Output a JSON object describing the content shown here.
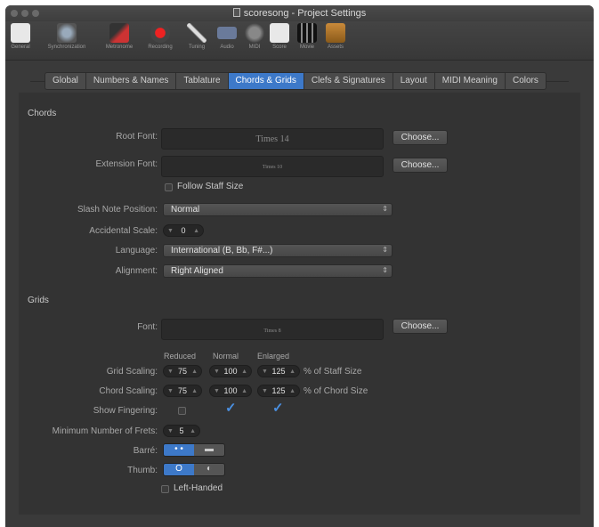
{
  "window": {
    "title": "scoresong - Project Settings"
  },
  "toolbar": {
    "items": [
      {
        "label": "General",
        "icon": "general-icon"
      },
      {
        "label": "Synchronization",
        "icon": "sync-icon"
      },
      {
        "label": "Metronome",
        "icon": "metronome-icon"
      },
      {
        "label": "Recording",
        "icon": "record-icon"
      },
      {
        "label": "Tuning",
        "icon": "tuning-icon"
      },
      {
        "label": "Audio",
        "icon": "audio-icon"
      },
      {
        "label": "MIDI",
        "icon": "midi-icon"
      },
      {
        "label": "Score",
        "icon": "score-icon"
      },
      {
        "label": "Movie",
        "icon": "movie-icon"
      },
      {
        "label": "Assets",
        "icon": "assets-icon"
      }
    ]
  },
  "tabs": [
    "Global",
    "Numbers & Names",
    "Tablature",
    "Chords & Grids",
    "Clefs & Signatures",
    "Layout",
    "MIDI Meaning",
    "Colors"
  ],
  "active_tab": "Chords & Grids",
  "chords": {
    "heading": "Chords",
    "root_font_label": "Root Font:",
    "root_font_value": "Times 14",
    "extension_font_label": "Extension Font:",
    "extension_font_value": "Times 10",
    "choose_label": "Choose...",
    "follow_staff_size": "Follow Staff Size",
    "slash_note_label": "Slash Note Position:",
    "slash_note_value": "Normal",
    "accidental_scale_label": "Accidental Scale:",
    "accidental_scale_value": "0",
    "language_label": "Language:",
    "language_value": "International (B, Bb, F#...)",
    "alignment_label": "Alignment:",
    "alignment_value": "Right Aligned"
  },
  "grids": {
    "heading": "Grids",
    "font_label": "Font:",
    "font_value": "Times 8",
    "choose_label": "Choose...",
    "col_reduced": "Reduced",
    "col_normal": "Normal",
    "col_enlarged": "Enlarged",
    "grid_scaling_label": "Grid Scaling:",
    "grid_scaling": [
      "75",
      "100",
      "125"
    ],
    "grid_scaling_unit": "% of Staff Size",
    "chord_scaling_label": "Chord Scaling:",
    "chord_scaling": [
      "75",
      "100",
      "125"
    ],
    "chord_scaling_unit": "% of Chord Size",
    "show_fingering_label": "Show Fingering:",
    "show_fingering": [
      false,
      true,
      true
    ],
    "min_frets_label": "Minimum Number of Frets:",
    "min_frets_value": "5",
    "barre_label": "Barré:",
    "thumb_label": "Thumb:",
    "left_handed": "Left-Handed"
  }
}
